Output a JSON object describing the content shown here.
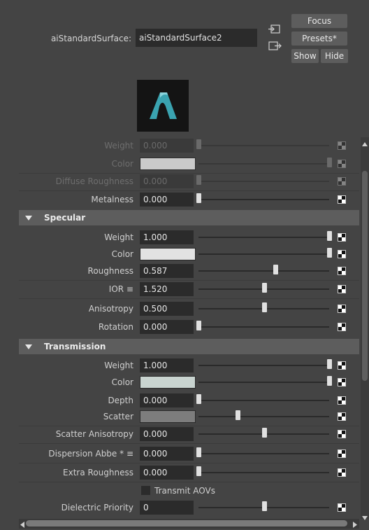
{
  "header": {
    "node_type_label": "aiStandardSurface:",
    "node_name": "aiStandardSurface2",
    "focus_label": "Focus",
    "presets_label": "Presets*",
    "show_label": "Show",
    "hide_label": "Hide"
  },
  "swatch": {
    "icon": "arnold-logo",
    "accent": "#3aa3b0"
  },
  "base_rows": [
    {
      "label": "Weight",
      "value": "0.000",
      "slider": 0.0,
      "dim": true,
      "type": "num"
    },
    {
      "label": "Color",
      "color": "#d9d9d9",
      "slider": 1.0,
      "dim": true,
      "type": "color"
    },
    {
      "label": "Diffuse Roughness",
      "value": "0.000",
      "slider": 0.0,
      "dim": true,
      "type": "num"
    },
    {
      "label": "Metalness",
      "value": "0.000",
      "slider": 0.0,
      "dim": false,
      "type": "num"
    }
  ],
  "specular": {
    "title": "Specular",
    "rows": [
      {
        "label": "Weight",
        "value": "1.000",
        "slider": 1.0,
        "type": "num"
      },
      {
        "label": "Color",
        "color": "#e2e2e2",
        "slider": 1.0,
        "type": "color"
      },
      {
        "label": "Roughness",
        "value": "0.587",
        "slider": 0.587,
        "type": "num"
      },
      {
        "label": "IOR ≡",
        "value": "1.520",
        "slider": 0.5,
        "type": "num"
      },
      {
        "label": "Anisotropy",
        "value": "0.500",
        "slider": 0.5,
        "type": "num"
      },
      {
        "label": "Rotation",
        "value": "0.000",
        "slider": 0.0,
        "type": "num"
      }
    ]
  },
  "transmission": {
    "title": "Transmission",
    "rows": [
      {
        "label": "Weight",
        "value": "1.000",
        "slider": 1.0,
        "type": "num"
      },
      {
        "label": "Color",
        "color": "#c9d4d0",
        "slider": 1.0,
        "type": "color"
      },
      {
        "label": "Depth",
        "value": "0.000",
        "slider": 0.0,
        "type": "num"
      },
      {
        "label": "Scatter",
        "color": "#7d7d7d",
        "slider": 0.3,
        "type": "color"
      },
      {
        "label": "Scatter Anisotropy",
        "value": "0.000",
        "slider": 0.5,
        "type": "num"
      },
      {
        "label": "Dispersion Abbe * ≡",
        "value": "0.000",
        "slider": 0.0,
        "type": "num"
      },
      {
        "label": "Extra Roughness",
        "value": "0.000",
        "slider": 0.0,
        "type": "num"
      },
      {
        "label": "Transmit AOVs",
        "type": "checkbox",
        "checked": false
      },
      {
        "label": "Dielectric Priority",
        "value": "0",
        "slider": 0.5,
        "type": "num"
      }
    ]
  }
}
